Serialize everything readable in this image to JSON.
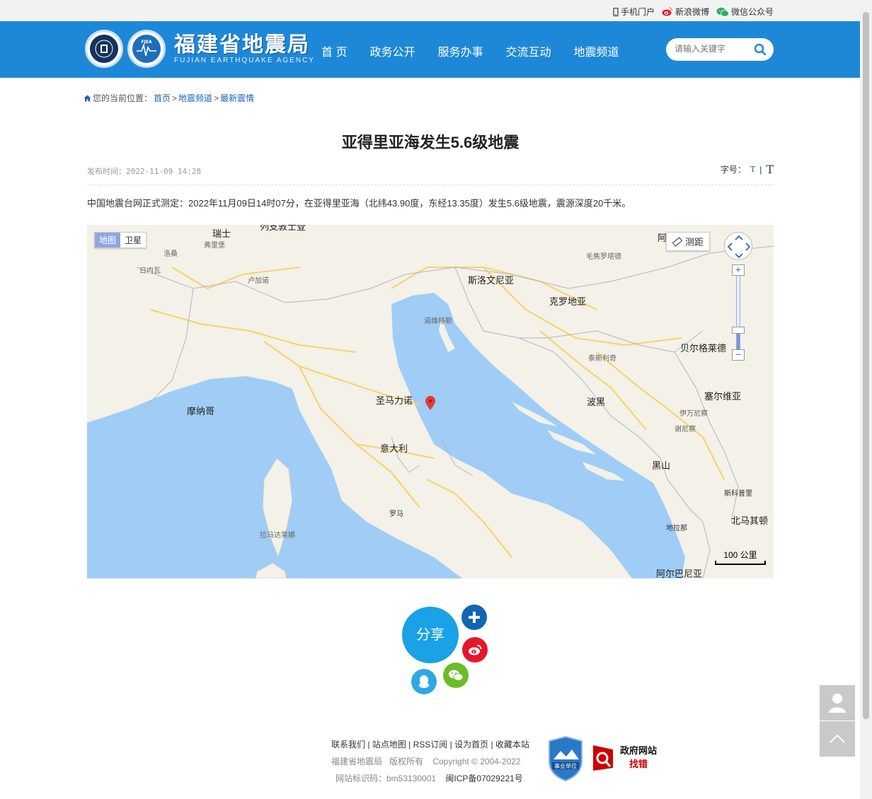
{
  "topbar": {
    "mobile": "手机门户",
    "weibo": "新浪微博",
    "wechat": "微信公众号"
  },
  "header": {
    "logo_cn": "福建省地震局",
    "logo_en": "FUJIAN EARTHQUAKE AGENCY",
    "seal_fjea": "FJEA",
    "nav": [
      "首 页",
      "政务公开",
      "服务办事",
      "交流互动",
      "地震频道"
    ],
    "search_placeholder": "请输入关键字"
  },
  "breadcrumb": {
    "prefix": "您的当前位置：",
    "items": [
      "首页",
      "地震频道",
      "最新震情"
    ],
    "separator": ">"
  },
  "article": {
    "title": "亚得里亚海发生5.6级地震",
    "published_label": "发布时间：",
    "published": "2022-11-09 14:28",
    "fontsize_label": "字号：",
    "fontsize_small": "T",
    "fontsize_sep": "|",
    "fontsize_big": "T",
    "body": "中国地震台网正式测定：2022年11月09日14时07分，在亚得里亚海（北纬43.90度，东经13.35度）发生5.6级地震，震源深度20千米。"
  },
  "map": {
    "type_map": "地图",
    "type_sat": "卫星",
    "measure": "测距",
    "scale": "100 公里",
    "labels": {
      "swiss": "瑞士",
      "fribourg": "弗里堡",
      "lausanne": "洛桑",
      "geneva": "日内瓦",
      "lugano": "卢加诺",
      "slovenia": "斯洛文尼亚",
      "croatia": "克罗地亚",
      "maribor": "毛焦罗塔德",
      "rijeka": "诺维格勒",
      "belgrade": "贝尔格莱德",
      "banjaluka": "泰斯利奇",
      "serbia": "塞尔维亚",
      "ivanjica": "伊万尼察",
      "sjenica": "谢尼察",
      "sanmarino": "圣马力诺",
      "monaco": "摩纳哥",
      "bosnia": "波黑",
      "italy": "意大利",
      "montenegro": "黑山",
      "skopje": "斯科普里",
      "rome": "罗马",
      "tirana": "地拉那",
      "northmacedonia": "北马其顿",
      "latina": "拉马达莱娜",
      "albania": "阿尔巴尼亚",
      "top_cut": "阿",
      "top_cut2": "列支敦士登"
    }
  },
  "share": {
    "label": "分享"
  },
  "footer": {
    "links": [
      "联系我们",
      "站点地图",
      "RSS订阅",
      "设为首页",
      "收藏本站"
    ],
    "copyright": "福建省地震局   版权所有    Copyright © 2004-2022",
    "site_code": "网站标识码：bm53130001",
    "icp": "闽ICP备07029221号",
    "badge_unit": "事业单位",
    "gov_site": "政府网站",
    "find_error": "找错"
  },
  "colors": {
    "header_blue": "#1e88d8",
    "share_blue": "#1aa1e6",
    "sea": "#9fcdf5",
    "marker": "#e53935"
  }
}
